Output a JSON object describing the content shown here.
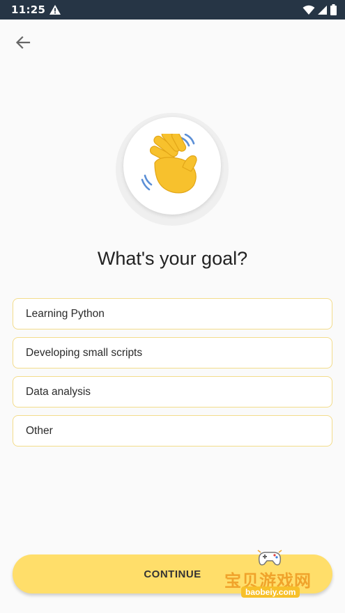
{
  "status_bar": {
    "time": "11:25",
    "icons": [
      "alert-triangle-icon",
      "wifi-icon",
      "signal-icon",
      "battery-icon"
    ]
  },
  "nav": {
    "back_icon": "arrow-left-icon"
  },
  "hero": {
    "emoji": "waving-hand-icon"
  },
  "title": "What's your goal?",
  "options": [
    {
      "label": "Learning Python"
    },
    {
      "label": "Developing small scripts"
    },
    {
      "label": "Data analysis"
    },
    {
      "label": "Other"
    }
  ],
  "continue_label": "CONTINUE",
  "watermark": {
    "text": "宝贝游戏网",
    "url": "baobeiy.com"
  },
  "colors": {
    "status_bar": "#263545",
    "accent": "#ffde6a",
    "option_border": "#f3dc8b",
    "background": "#fafafa"
  }
}
